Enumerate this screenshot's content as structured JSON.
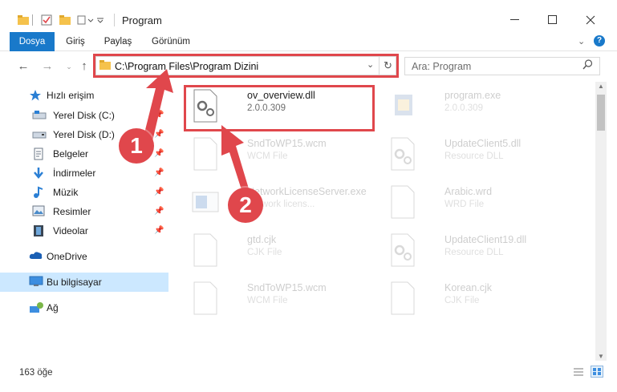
{
  "window": {
    "title": "Program"
  },
  "ribbon": {
    "tabs": [
      {
        "label": "Dosya"
      },
      {
        "label": "Giriş"
      },
      {
        "label": "Paylaş"
      },
      {
        "label": "Görünüm"
      }
    ]
  },
  "address": {
    "path": "C:\\Program Files\\Program Dizini"
  },
  "search": {
    "placeholder": "Ara: Program"
  },
  "sidebar": {
    "quick_access": "Hızlı erişim",
    "items": [
      {
        "label": "Yerel Disk (C:)"
      },
      {
        "label": "Yerel Disk (D:)"
      },
      {
        "label": "Belgeler"
      },
      {
        "label": "İndirmeler"
      },
      {
        "label": "Müzik"
      },
      {
        "label": "Resimler"
      },
      {
        "label": "Videolar"
      }
    ],
    "onedrive": "OneDrive",
    "this_pc": "Bu bilgisayar",
    "network": "Ağ"
  },
  "files": [
    {
      "name": "ov_overview.dll",
      "sub": "2.0.0.309",
      "icon": "dll-gear-icon"
    },
    {
      "name": "program.exe",
      "sub": "2.0.0.309",
      "icon": "exe-icon"
    },
    {
      "name": "SndToWP15.wcm",
      "sub": "WCM File",
      "icon": "file-icon"
    },
    {
      "name": "UpdateClient5.dll",
      "sub": "Resource DLL",
      "icon": "dll-gear-icon"
    },
    {
      "name": "NetworkLicenseServer.exe",
      "sub": "Network licens...",
      "icon": "app-icon"
    },
    {
      "name": "Arabic.wrd",
      "sub": "WRD File",
      "icon": "file-icon"
    },
    {
      "name": "gtd.cjk",
      "sub": "CJK File",
      "icon": "file-icon"
    },
    {
      "name": "UpdateClient19.dll",
      "sub": "Resource DLL",
      "icon": "dll-gear-icon"
    },
    {
      "name": "SndToWP15.wcm",
      "sub": "WCM File",
      "icon": "file-icon"
    },
    {
      "name": "Korean.cjk",
      "sub": "CJK File",
      "icon": "file-icon"
    }
  ],
  "status": {
    "count": "163 öğe"
  },
  "callouts": {
    "one": "1",
    "two": "2"
  },
  "colors": {
    "accent": "#1979ca",
    "highlight": "#e0474c",
    "folder": "#f5c24c"
  }
}
